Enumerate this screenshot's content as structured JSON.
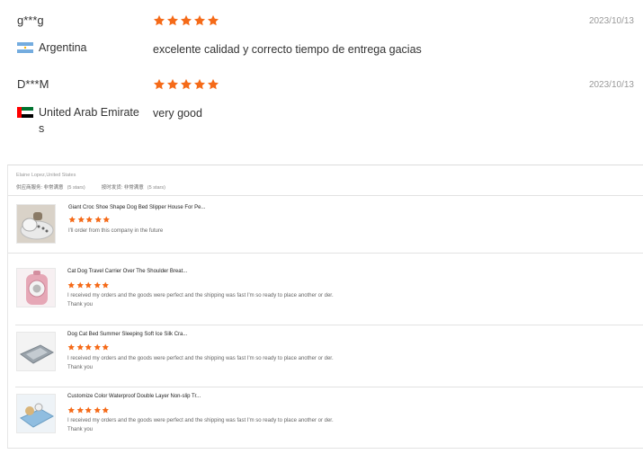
{
  "reviews": [
    {
      "name": "g***g",
      "date": "2023/10/13",
      "country": "Argentina",
      "flag": "argentina-flag",
      "text": "excelente calidad y correcto tiempo de entrega gacias",
      "rating": 5
    },
    {
      "name": "D***M",
      "date": "2023/10/13",
      "country": "United Arab Emirates",
      "flag": "uae-flag",
      "text": "very good",
      "rating": 5
    }
  ],
  "store_review": {
    "reviewer": "Elaine Lopez,United States",
    "supplier_label": "供应商服务: 非常满意",
    "supplier_stars": "(5 stars)",
    "delivery_label": "按时发货: 非常满意",
    "delivery_stars": "(5 stars)",
    "products": [
      {
        "title": "Giant Croc Shoe Shape Dog Bed Slipper House For Pe...",
        "comment": "I'll order from this company in the future",
        "rating": 5,
        "thumb": "croc-shoe-bed-thumbnail"
      }
    ]
  },
  "order_review": {
    "products": [
      {
        "title": "Cat Dog Travel Carrier Over The Shoulder Breat...",
        "comment": "I received my orders and the goods were perfect and the shipping was fast I'm so ready to place another or der. Thank you",
        "rating": 5,
        "thumb": "pink-carrier-thumbnail"
      },
      {
        "title": "Dog Cat Bed Summer Sleeping Soft Ice Silk Cra...",
        "comment": "I received my orders and the goods were perfect and the shipping was fast I'm so ready to place another or der. Thank you",
        "rating": 5,
        "thumb": "grey-bed-thumbnail"
      },
      {
        "title": "Customize Color Waterproof Double Layer Non-slip Tr...",
        "comment": "I received my orders and the goods were perfect and the shipping was fast I'm so ready to place another or der. Thank you",
        "rating": 5,
        "thumb": "blue-mat-thumbnail"
      }
    ]
  },
  "colors": {
    "star": "#f56a18",
    "date": "#999999"
  }
}
